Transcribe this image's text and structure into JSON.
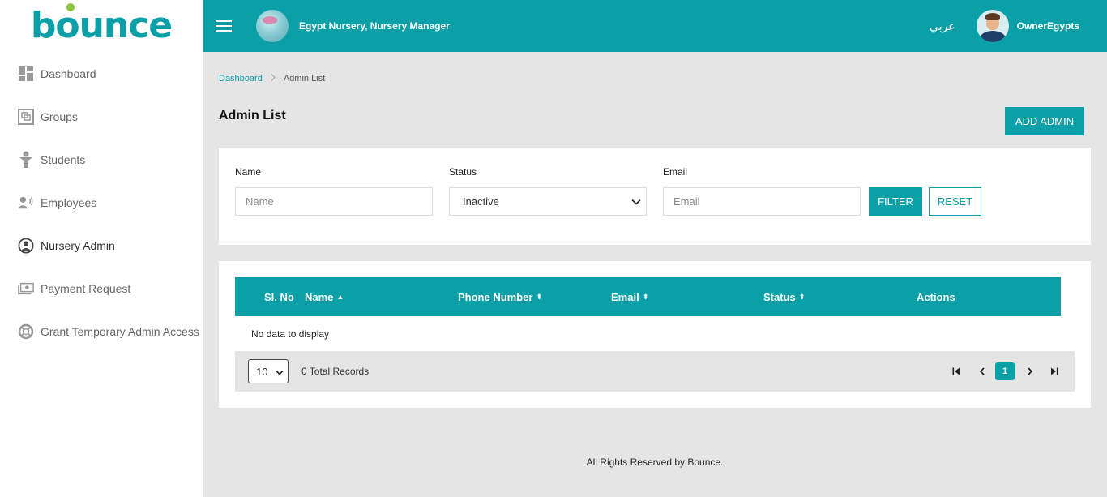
{
  "brand": {
    "logo_text_b": "b",
    "logo_text_rest": "unce",
    "accent_color": "#0b9fa7",
    "logo_dot_color": "#8cc63f"
  },
  "sidebar": {
    "items": [
      {
        "label": "Dashboard",
        "icon": "dashboard-icon"
      },
      {
        "label": "Groups",
        "icon": "groups-icon"
      },
      {
        "label": "Students",
        "icon": "student-icon"
      },
      {
        "label": "Employees",
        "icon": "employees-icon"
      },
      {
        "label": "Nursery Admin",
        "icon": "user-circle-icon",
        "active": true
      },
      {
        "label": "Payment Request",
        "icon": "money-icon"
      },
      {
        "label": "Grant Temporary Admin Access",
        "icon": "lifebuoy-icon"
      }
    ]
  },
  "topbar": {
    "org_title": "Egypt Nursery, Nursery Manager",
    "language_toggle": "عربي",
    "username": "OwnerEgypts"
  },
  "breadcrumb": {
    "home": "Dashboard",
    "current": "Admin List"
  },
  "page": {
    "title": "Admin List",
    "add_button": "ADD ADMIN"
  },
  "filters": {
    "name": {
      "label": "Name",
      "placeholder": "Name",
      "value": ""
    },
    "status": {
      "label": "Status",
      "value": "Inactive"
    },
    "email": {
      "label": "Email",
      "placeholder": "Email",
      "value": ""
    },
    "filter_button": "FILTER",
    "reset_button": "RESET"
  },
  "table": {
    "columns": [
      "Sl. No",
      "Name",
      "Phone Number",
      "Email",
      "Status",
      "Actions"
    ],
    "sort_up": "▲",
    "sort_both": "⬍",
    "rows": [],
    "empty_message": "No data to display"
  },
  "pagination": {
    "page_size": "10",
    "total": "0 Total Records",
    "current_page": "1"
  },
  "footer": "All Rights Reserved by Bounce."
}
